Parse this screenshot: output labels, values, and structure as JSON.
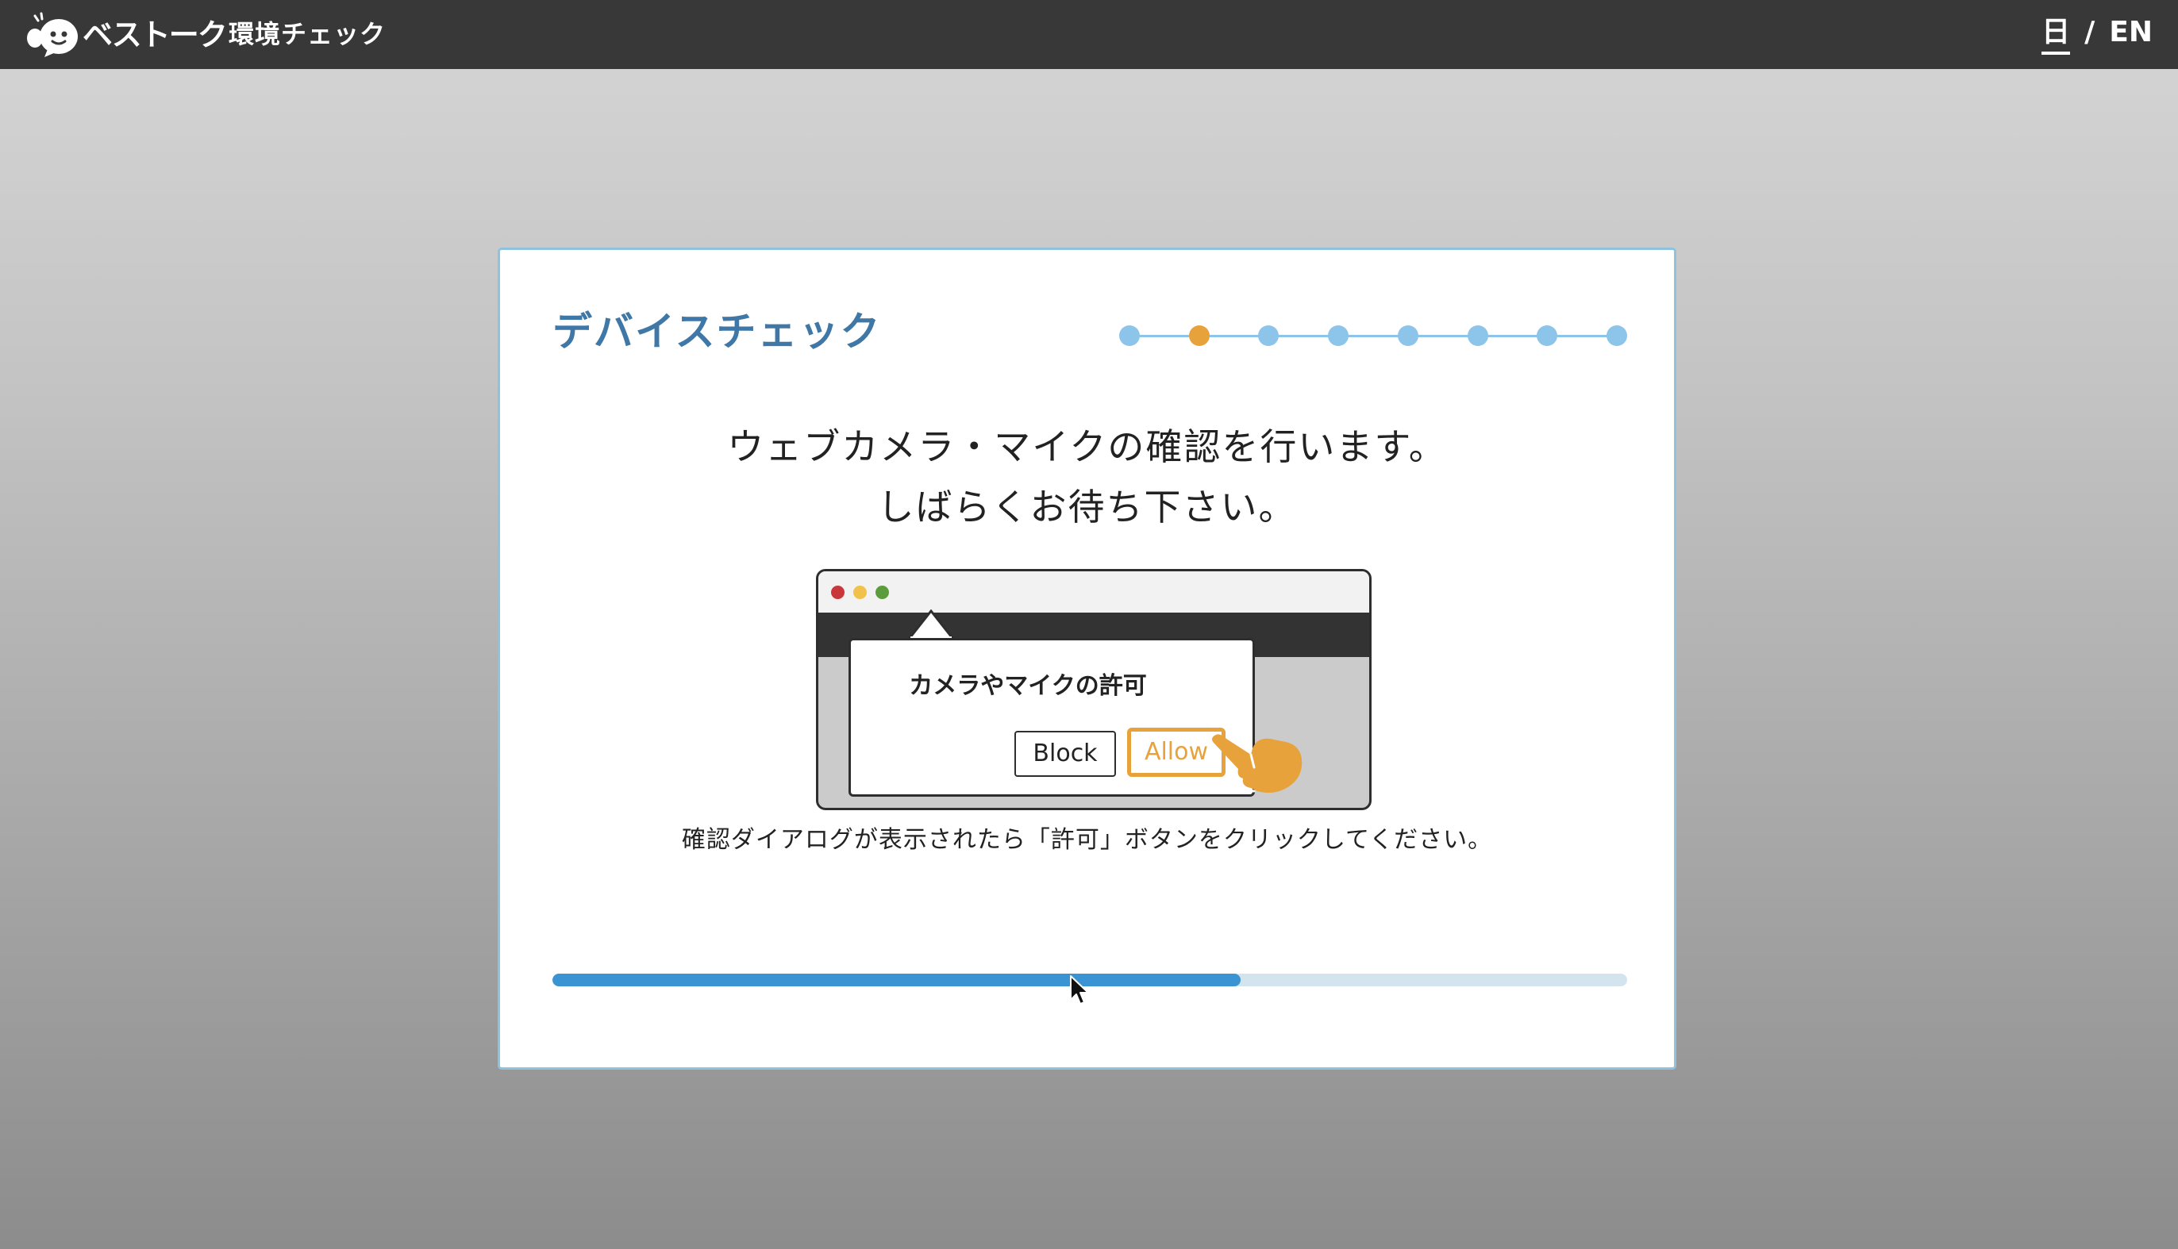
{
  "header": {
    "logo_text": "ベストーク",
    "title": "環境チェック",
    "lang_ja": "日",
    "lang_separator": "/",
    "lang_en": "EN"
  },
  "card": {
    "title": "デバイスチェック",
    "steps": {
      "total": 8,
      "current": 2
    },
    "message_line1": "ウェブカメラ・マイクの確認を行います。",
    "message_line2": "しばらくお待ち下さい。",
    "illustration": {
      "dialog_title": "カメラやマイクの許可",
      "block_label": "Block",
      "allow_label": "Allow"
    },
    "instruction": "確認ダイアログが表示されたら「許可」ボタンをクリックしてください。",
    "progress_percent": 64
  },
  "colors": {
    "header_bg": "#383838",
    "title_blue": "#3f77a6",
    "step_dot": "#8dc4ea",
    "step_active": "#e8a23b",
    "progress_fill": "#3a93d3",
    "progress_track": "#d3e4ef",
    "allow_orange": "#e8a23b"
  },
  "icons": {
    "logo": "speech-bubble-face-logo-icon",
    "hand": "pointing-hand-icon",
    "cursor": "mouse-pointer-icon"
  }
}
